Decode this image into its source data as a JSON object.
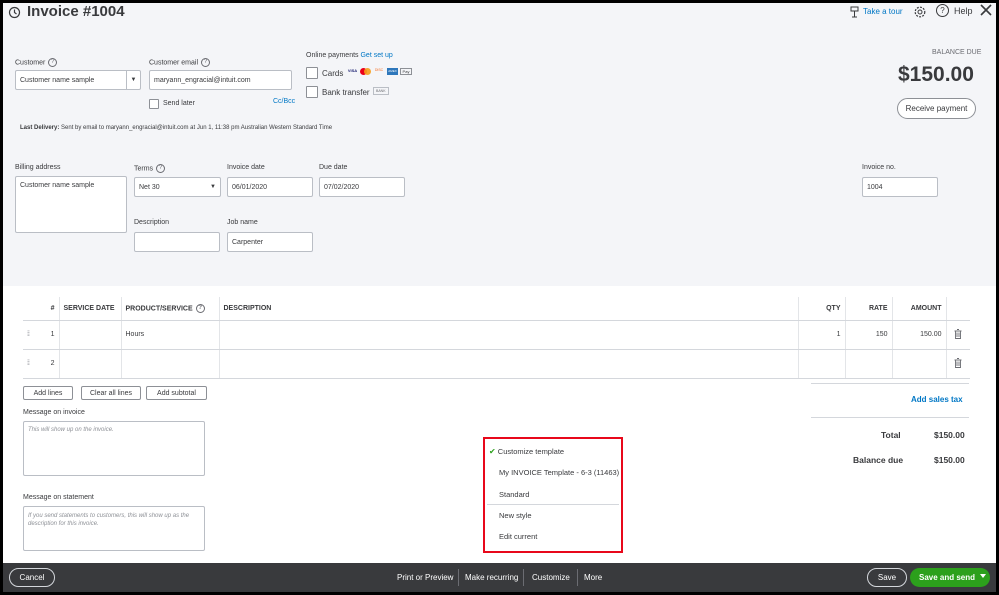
{
  "header": {
    "title": "Invoice #1004",
    "take_tour": "Take a tour",
    "help": "Help"
  },
  "customer": {
    "label": "Customer",
    "value": "Customer name sample",
    "email_label": "Customer email",
    "email_value": "maryann_engracial@intuit.com",
    "send_later": "Send later",
    "cc_bcc": "Cc/Bcc"
  },
  "online_payments": {
    "label": "Online payments",
    "get_set_up": "Get set up",
    "cards": "Cards",
    "card_brands": [
      "VISA",
      "MC",
      "DISC",
      "AMEX",
      "Pay"
    ],
    "bank_transfer": "Bank transfer",
    "bank_logo": "BANK"
  },
  "balance": {
    "label": "BALANCE DUE",
    "amount": "$150.00",
    "receive_payment": "Receive payment"
  },
  "last_delivery": {
    "label": "Last Delivery:",
    "text": "Sent by email to maryann_engracial@intuit.com at Jun 1, 11:38 pm Australian Western Standard Time"
  },
  "billing": {
    "label": "Billing address",
    "value": "Customer name sample"
  },
  "terms": {
    "label": "Terms",
    "value": "Net 30"
  },
  "invoice_date": {
    "label": "Invoice date",
    "value": "06/01/2020"
  },
  "due_date": {
    "label": "Due date",
    "value": "07/02/2020"
  },
  "invoice_no": {
    "label": "Invoice no.",
    "value": "1004"
  },
  "description": {
    "label": "Description",
    "value": ""
  },
  "job_name": {
    "label": "Job name",
    "value": "Carpenter"
  },
  "lines": {
    "columns": [
      "#",
      "SERVICE DATE",
      "PRODUCT/SERVICE",
      "DESCRIPTION",
      "QTY",
      "RATE",
      "AMOUNT"
    ],
    "rows": [
      {
        "num": "1",
        "service_date": "",
        "product": "Hours",
        "description": "",
        "qty": "1",
        "rate": "150",
        "amount": "150.00"
      },
      {
        "num": "2",
        "service_date": "",
        "product": "",
        "description": "",
        "qty": "",
        "rate": "",
        "amount": ""
      }
    ],
    "add_lines": "Add lines",
    "clear_all_lines": "Clear all lines",
    "add_subtotal": "Add subtotal"
  },
  "messages": {
    "invoice_label": "Message on invoice",
    "invoice_placeholder": "This will show up on the invoice.",
    "statement_label": "Message on statement",
    "statement_placeholder": "If you send statements to customers, this will show up as the description for this invoice."
  },
  "totals": {
    "add_sales_tax": "Add sales tax",
    "total_label": "Total",
    "total_value": "$150.00",
    "balance_due_label": "Balance due",
    "balance_due_value": "$150.00"
  },
  "customize_menu": {
    "items": [
      "Customize template",
      "My INVOICE Template - 6-3 (11463)",
      "Standard",
      "New style",
      "Edit current"
    ]
  },
  "footer": {
    "cancel": "Cancel",
    "print_preview": "Print or Preview",
    "make_recurring": "Make recurring",
    "customize": "Customize",
    "more": "More",
    "save": "Save",
    "save_and_send": "Save and send"
  },
  "colors": {
    "accent_green": "#2ca01c",
    "link_blue": "#0077c5",
    "footer_bg": "#393a3d",
    "highlight_red": "#e8081b"
  }
}
